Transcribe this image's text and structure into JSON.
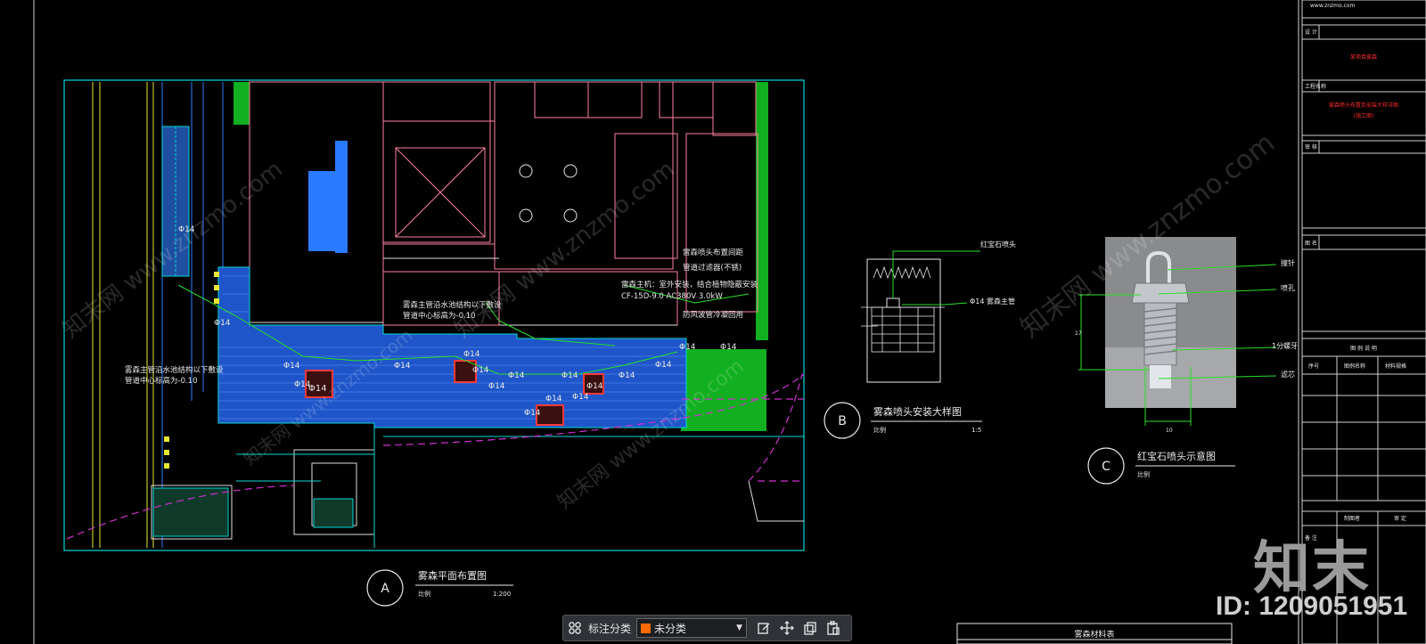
{
  "drawing": {
    "site_note": "知 末 www.znzmo.com",
    "detail_a": {
      "label": "A",
      "title": "雾森平面布置图",
      "scale_label": "比例",
      "scale": "1:200"
    },
    "detail_b": {
      "label": "B",
      "title": "雾森喷头安装大样图",
      "scale_label": "比例",
      "scale": "1:5",
      "callout_1": "红宝石喷头",
      "callout_2": "Φ14 雾森主管"
    },
    "detail_c": {
      "label": "C",
      "title": "红宝石喷头示意图",
      "scale_label": "比例",
      "callout_1": "撞针",
      "callout_2": "喷孔",
      "callout_3": "1分螺牙",
      "callout_4": "滤芯",
      "dim_h": "17",
      "dim_w": "10"
    },
    "notes": {
      "note_1": "雾森主管沿水池结构以下敷设",
      "note_2": "管道中心标高为-0.10",
      "note_3": "雾森主管沿水池结构以下敷设",
      "note_4": "管道中心标高为-0.10",
      "note_5": "雷森主机：室外安装，结合植物隐蔽安装",
      "note_6": "CF-15D-9.0 AC380V 3.0kW",
      "note_7": "雷森喷头布置间距",
      "note_8": "管道过滤器(不锈)",
      "note_9": "防风波管冷凝回用"
    },
    "pipe_tags": [
      "Φ14",
      "Φ14",
      "Φ14",
      "Φ14",
      "Φ14",
      "Φ14",
      "Φ14",
      "Φ14",
      "Φ14",
      "Φ14",
      "Φ14",
      "Φ14",
      "Φ14",
      "Φ14",
      "Φ14",
      "Φ14",
      "Φ14",
      "Φ14"
    ],
    "pipe_tag_main": "Φ14",
    "material_table_title": "雾森材料表"
  },
  "titleblock": {
    "rows": [
      "设 计",
      "审 核",
      "图 名",
      "备 注"
    ],
    "project_label": "工程名称",
    "project_red": "某项目雾森",
    "drawing_red_1": "雾森喷头布置及安装大样详图",
    "drawing_red_2": "(施工图)",
    "legend_title": "图 例 说 明",
    "legend_cols": [
      "序号",
      "图例名称",
      "材料规格"
    ],
    "sign_labels": [
      "制图者",
      "审 定"
    ],
    "top_text": "www.znzmo.com"
  },
  "watermarks": [
    "知末网 www.znzmo.com",
    "知末网 www.znzmo.com",
    "知末网 www.znzmo.com",
    "知末网 www.znzmo.com",
    "知末网 www.znzmo.com"
  ],
  "logo": "知末",
  "id_text": "ID: 1209051951",
  "toolbar": {
    "label": "标注分类",
    "select_value": "未分类",
    "accent": "#ff6a00"
  },
  "colors": {
    "cyan": "#00d8d8",
    "blue": "#2a7bff",
    "green": "#12b020",
    "red": "#e03030",
    "pink": "#ff7fa0",
    "magenta": "#d030d0",
    "yellow": "#e8e830",
    "white": "#e8e8e8"
  }
}
